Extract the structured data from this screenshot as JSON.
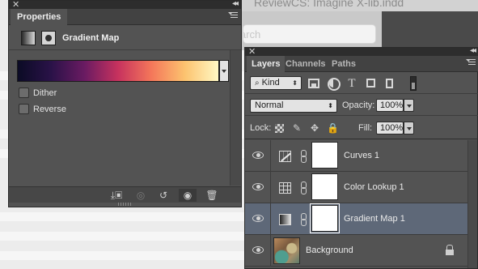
{
  "document": {
    "title_fragment": "ReviewCS: Imagine X-lib.indd",
    "search_placeholder": "Search"
  },
  "properties_panel": {
    "close_glyph": "✕",
    "collapse_glyph": "◂◂",
    "tab_label": "Properties",
    "adjustment_title": "Gradient Map",
    "gradient_colors": [
      "#0b0b25",
      "#2a1248",
      "#6a1b62",
      "#c7325e",
      "#f4775a",
      "#fcc36f",
      "#fff8c4"
    ],
    "dither_label": "Dither",
    "dither_checked": false,
    "reverse_label": "Reverse",
    "reverse_checked": false,
    "footer_icons": [
      "clip-to-layer-icon",
      "view-previous-state-icon",
      "reset-icon",
      "visibility-eye-icon",
      "trash-icon"
    ]
  },
  "layers_panel": {
    "close_glyph": "✕",
    "collapse_glyph": "◂◂",
    "tabs": [
      {
        "label": "Layers",
        "active": true
      },
      {
        "label": "Channels",
        "active": false
      },
      {
        "label": "Paths",
        "active": false
      }
    ],
    "filter_kind": "Kind",
    "blend_mode": "Normal",
    "opacity_label": "Opacity:",
    "opacity_value": "100%",
    "lock_label": "Lock:",
    "fill_label": "Fill:",
    "fill_value": "100%",
    "layers": [
      {
        "name": "Curves 1",
        "type": "curves-adjustment",
        "selected": false
      },
      {
        "name": "Color Lookup 1",
        "type": "color-lookup-adjustment",
        "selected": false
      },
      {
        "name": "Gradient Map 1",
        "type": "gradient-map-adjustment",
        "selected": true
      },
      {
        "name": "Background",
        "type": "image",
        "selected": false,
        "locked": true
      }
    ],
    "selected_row_color": "#5e6878"
  }
}
